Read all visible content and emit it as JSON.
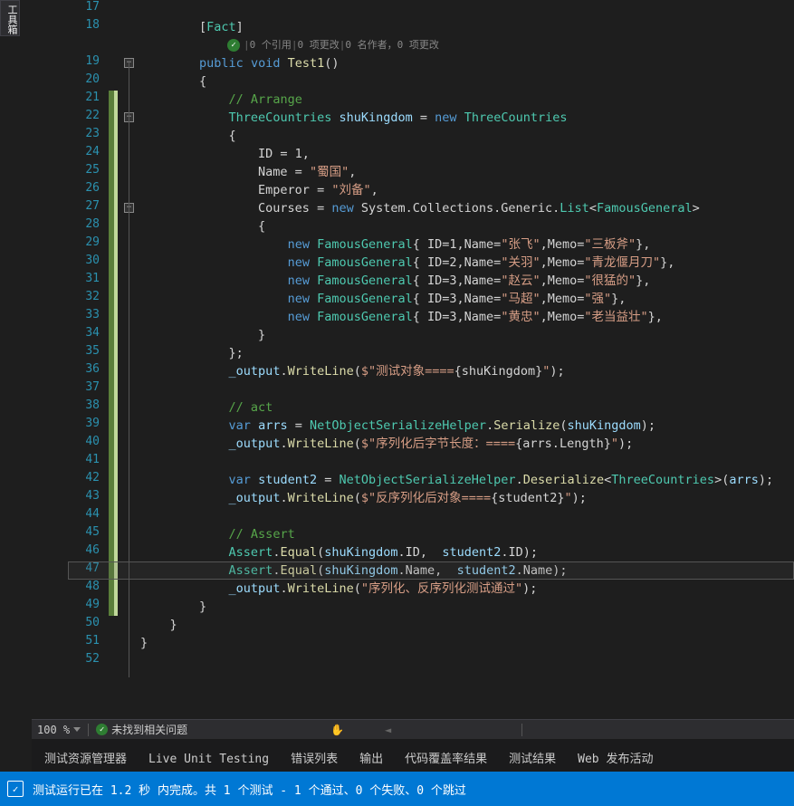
{
  "toolbox_label": "工具箱",
  "lines": [
    {
      "n": 17,
      "ch": false
    },
    {
      "n": 18,
      "ch": false
    },
    {
      "n": null,
      "ch": false
    },
    {
      "n": 19,
      "ch": false,
      "fold": "-"
    },
    {
      "n": 20,
      "ch": false
    },
    {
      "n": 21,
      "ch": true
    },
    {
      "n": 22,
      "ch": true,
      "fold": "-"
    },
    {
      "n": 23,
      "ch": true
    },
    {
      "n": 24,
      "ch": true
    },
    {
      "n": 25,
      "ch": true
    },
    {
      "n": 26,
      "ch": true
    },
    {
      "n": 27,
      "ch": true,
      "fold": "-"
    },
    {
      "n": 28,
      "ch": true
    },
    {
      "n": 29,
      "ch": true
    },
    {
      "n": 30,
      "ch": true
    },
    {
      "n": 31,
      "ch": true
    },
    {
      "n": 32,
      "ch": true
    },
    {
      "n": 33,
      "ch": true
    },
    {
      "n": 34,
      "ch": true
    },
    {
      "n": 35,
      "ch": true
    },
    {
      "n": 36,
      "ch": true
    },
    {
      "n": 37,
      "ch": true
    },
    {
      "n": 38,
      "ch": true
    },
    {
      "n": 39,
      "ch": true
    },
    {
      "n": 40,
      "ch": true
    },
    {
      "n": 41,
      "ch": true
    },
    {
      "n": 42,
      "ch": true
    },
    {
      "n": 43,
      "ch": true
    },
    {
      "n": 44,
      "ch": true
    },
    {
      "n": 45,
      "ch": true
    },
    {
      "n": 46,
      "ch": true
    },
    {
      "n": 47,
      "ch": true,
      "hl": true
    },
    {
      "n": 48,
      "ch": true
    },
    {
      "n": 49,
      "ch": true
    },
    {
      "n": 50,
      "ch": false
    },
    {
      "n": 51,
      "ch": false
    },
    {
      "n": 52,
      "ch": false
    }
  ],
  "codelens": {
    "refs": "0 个引用",
    "changes1": "0 项更改",
    "authors": "0 名作者",
    "changes2": "0 项更改"
  },
  "code": {
    "l18": {
      "attr": "Fact"
    },
    "l19": {
      "kw1": "public",
      "kw2": "void",
      "name": "Test1"
    },
    "l21": {
      "c": "// Arrange"
    },
    "l22": {
      "t": "ThreeCountries",
      "v": "shuKingdom",
      "kw": "new",
      "t2": "ThreeCountries"
    },
    "l24": {
      "p": "ID",
      "v": "1"
    },
    "l25": {
      "p": "Name",
      "v": "\"蜀国\""
    },
    "l26": {
      "p": "Emperor",
      "v": "\"刘备\""
    },
    "l27": {
      "p": "Courses",
      "kw": "new",
      "ns": "System.Collections.Generic.",
      "t": "List",
      "g": "FamousGeneral"
    },
    "l29": {
      "kw": "new",
      "t": "FamousGeneral",
      "body": "{ ID=1,Name=",
      "s1": "\"张飞\"",
      "m": ",Memo=",
      "s2": "\"三板斧\"",
      "e": "},"
    },
    "l30": {
      "kw": "new",
      "t": "FamousGeneral",
      "body": "{ ID=2,Name=",
      "s1": "\"关羽\"",
      "m": ",Memo=",
      "s2": "\"青龙偃月刀\"",
      "e": "},"
    },
    "l31": {
      "kw": "new",
      "t": "FamousGeneral",
      "body": "{ ID=3,Name=",
      "s1": "\"赵云\"",
      "m": ",Memo=",
      "s2": "\"很猛的\"",
      "e": "},"
    },
    "l32": {
      "kw": "new",
      "t": "FamousGeneral",
      "body": "{ ID=3,Name=",
      "s1": "\"马超\"",
      "m": ",Memo=",
      "s2": "\"强\"",
      "e": "},"
    },
    "l33": {
      "kw": "new",
      "t": "FamousGeneral",
      "body": "{ ID=3,Name=",
      "s1": "\"黄忠\"",
      "m": ",Memo=",
      "s2": "\"老当益壮\"",
      "e": "},"
    },
    "l36": {
      "o": "_output",
      "m": "WriteLine",
      "s1": "$\"测试对象====",
      "i": "{shuKingdom}",
      "s2": "\""
    },
    "l38": {
      "c": "// act"
    },
    "l39": {
      "kw": "var",
      "v": "arrs",
      "t": "NetObjectSerializeHelper",
      "m": "Serialize",
      "a": "shuKingdom"
    },
    "l40": {
      "o": "_output",
      "m": "WriteLine",
      "s1": "$\"序列化后字节长度：====",
      "i": "{arrs.Length}",
      "s2": "\""
    },
    "l42": {
      "kw": "var",
      "v": "student2",
      "t": "NetObjectSerializeHelper",
      "m": "Deserialize",
      "g": "ThreeCountries",
      "a": "arrs"
    },
    "l43": {
      "o": "_output",
      "m": "WriteLine",
      "s1": "$\"反序列化后对象====",
      "i": "{student2}",
      "s2": "\""
    },
    "l45": {
      "c": "// Assert"
    },
    "l46": {
      "t": "Assert",
      "m": "Equal",
      "a1": "shuKingdom",
      "p1": "ID",
      "a2": "student2",
      "p2": "ID"
    },
    "l47": {
      "t": "Assert",
      "m": "Equal",
      "a1": "shuKingdom",
      "p1": "Name",
      "a2": "student2",
      "p2": "Name"
    },
    "l48": {
      "o": "_output",
      "m": "WriteLine",
      "s": "\"序列化、反序列化测试通过\""
    }
  },
  "bottom": {
    "zoom": "100 %",
    "issues": "未找到相关问题"
  },
  "tabs": [
    "测试资源管理器",
    "Live Unit Testing",
    "错误列表",
    "输出",
    "代码覆盖率结果",
    "测试结果",
    "Web 发布活动"
  ],
  "status": "测试运行已在 1.2 秒 内完成。共 1 个测试 - 1 个通过、0 个失败、0 个跳过"
}
